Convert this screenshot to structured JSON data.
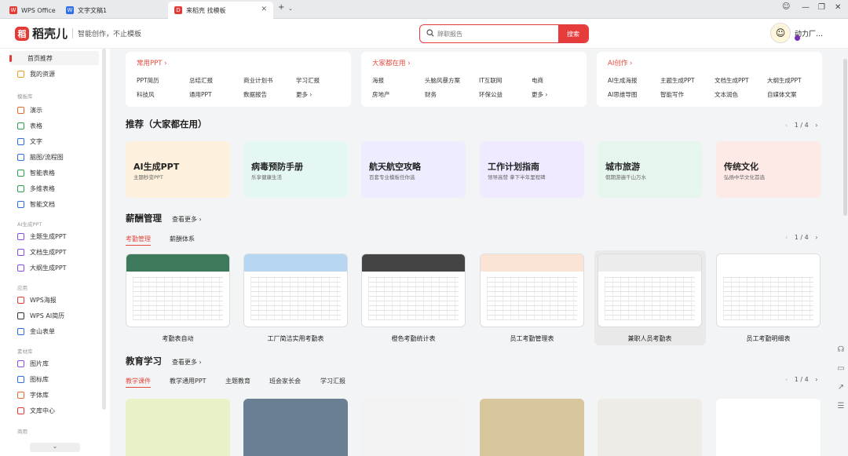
{
  "tabs": [
    {
      "label": "WPS Office",
      "icon": "wps-logo-icon"
    },
    {
      "label": "文字文稿1",
      "icon": "word-doc-icon"
    },
    {
      "label": "来稻壳 找模板",
      "icon": "docer-icon"
    }
  ],
  "header": {
    "logo_mark": "稻",
    "logo_name": "稻壳儿",
    "slogan": "智能创作，不止模板",
    "search_placeholder": "辞职报告",
    "search_button": "搜索",
    "user_name": "动力厂…"
  },
  "sidebar": {
    "top": [
      {
        "label": "首页推荐"
      },
      {
        "label": "我的资源"
      }
    ],
    "section_library": "模板库",
    "library": [
      {
        "label": "演示"
      },
      {
        "label": "表格"
      },
      {
        "label": "文字"
      },
      {
        "label": "脑图/流程图"
      },
      {
        "label": "智能表格"
      },
      {
        "label": "多维表格"
      },
      {
        "label": "智能文档"
      }
    ],
    "section_ai": "AI生成PPT",
    "ai": [
      {
        "label": "主题生成PPT"
      },
      {
        "label": "文档生成PPT"
      },
      {
        "label": "大纲生成PPT"
      }
    ],
    "section_apps": "应用",
    "apps": [
      {
        "label": "WPS海报"
      },
      {
        "label": "WPS AI简历"
      },
      {
        "label": "金山表单"
      }
    ],
    "section_materials": "素材库",
    "materials": [
      {
        "label": "图片库"
      },
      {
        "label": "图标库"
      },
      {
        "label": "字体库"
      },
      {
        "label": "文库中心"
      }
    ],
    "section_shop": "商用"
  },
  "categories": [
    {
      "title": "常用PPT",
      "links": [
        "PPT简历",
        "总结汇报",
        "商业计划书",
        "学习汇报",
        "科技风",
        "通用PPT",
        "数据报告",
        "更多"
      ]
    },
    {
      "title": "大家都在用",
      "links": [
        "海报",
        "头脑风暴方案",
        "IT互联网",
        "电商",
        "房地产",
        "财务",
        "环保公益",
        "更多"
      ]
    },
    {
      "title": "AI创作",
      "links": [
        "AI生成海报",
        "主题生成PPT",
        "文档生成PPT",
        "大纲生成PPT",
        "AI思维导图",
        "智能写作",
        "文本润色",
        "自媒体文案"
      ]
    }
  ],
  "recommend": {
    "title": "推荐（大家都在用）",
    "pager": "1 / 4",
    "cards": [
      {
        "title": "AI生成PPT",
        "sub": "主题秒变PPT",
        "color": "#fdf0dc"
      },
      {
        "title": "病毒预防手册",
        "sub": "乐享健康生活",
        "color": "#e4f7f4"
      },
      {
        "title": "航天航空攻略",
        "sub": "百套专业模板任你选",
        "color": "#eceeff"
      },
      {
        "title": "工作计划指南",
        "sub": "领导高赞 拿下半年里程碑",
        "color": "#efeaff"
      },
      {
        "title": "城市旅游",
        "sub": "假期游遍千山万水",
        "color": "#e6f6ee"
      },
      {
        "title": "传统文化",
        "sub": "弘扬中华文化首选",
        "color": "#fde9e6"
      }
    ]
  },
  "salary": {
    "title": "薪酬管理",
    "see_more": "查看更多",
    "tabs": [
      "考勤管理",
      "薪酬体系"
    ],
    "pager": "1 / 4",
    "templates": [
      {
        "caption": "考勤表自动",
        "color": "#3d7a5b"
      },
      {
        "caption": "工厂简洁实用考勤表",
        "color": "#b7d6f2"
      },
      {
        "caption": "橙色考勤统计表",
        "color": "#444444"
      },
      {
        "caption": "员工考勤管理表",
        "color": "#fbe3d6"
      },
      {
        "caption": "兼职人员考勤表",
        "color": "#ececec"
      },
      {
        "caption": "员工考勤明细表",
        "color": "#ffffff"
      }
    ]
  },
  "education": {
    "title": "教育学习",
    "see_more": "查看更多",
    "tabs": [
      "教学课件",
      "教学通用PPT",
      "主题教育",
      "班会家长会",
      "学习汇报"
    ],
    "pager": "1 / 4",
    "thumbs": [
      {
        "color": "#e8f2c8"
      },
      {
        "color": "#6a7f94"
      },
      {
        "color": "#f3f3f3"
      },
      {
        "color": "#d8c69c"
      },
      {
        "color": "#eeece6"
      },
      {
        "color": "#ffffff"
      }
    ]
  }
}
